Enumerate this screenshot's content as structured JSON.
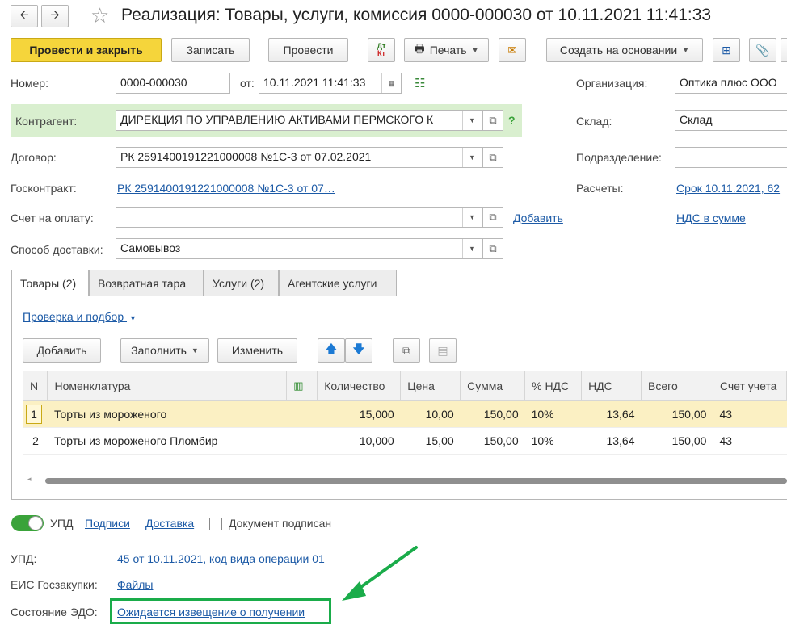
{
  "window": {
    "title": "Реализация: Товары, услуги, комиссия 0000-000030 от 10.11.2021 11:41:33"
  },
  "toolbar": {
    "post_close": "Провести и закрыть",
    "save": "Записать",
    "post": "Провести",
    "dtkt": "Дт Кт",
    "print": "Печать",
    "create_based": "Создать на основании"
  },
  "form": {
    "number_label": "Номер:",
    "number": "0000-000030",
    "from_label": "от:",
    "date": "10.11.2021 11:41:33",
    "org_label": "Организация:",
    "org": "Оптика плюс ООО",
    "contractor_label": "Контрагент:",
    "contractor": "ДИРЕКЦИЯ ПО УПРАВЛЕНИЮ АКТИВАМИ ПЕРМСКОГО К",
    "help": "?",
    "warehouse_label": "Склад:",
    "warehouse": "Склад",
    "contract_label": "Договор:",
    "contract": "РК 2591400191221000008 №1С-3 от 07.02.2021",
    "division_label": "Подразделение:",
    "division": "",
    "gov_contract_label": "Госконтракт:",
    "gov_contract": "РК 2591400191221000008 №1С-3 от 07…",
    "settlements_label": "Расчеты:",
    "settlements": "Срок 10.11.2021, 62",
    "invoice_label": "Счет на оплату:",
    "invoice": "",
    "add_link": "Добавить",
    "vat_link": "НДС в сумме",
    "delivery_label": "Способ доставки:",
    "delivery": "Самовывоз"
  },
  "tabs": [
    {
      "label": "Товары (2)"
    },
    {
      "label": "Возвратная тара"
    },
    {
      "label": "Услуги (2)"
    },
    {
      "label": "Агентские услуги"
    }
  ],
  "goods": {
    "check_link": "Проверка и подбор",
    "add": "Добавить",
    "fill": "Заполнить",
    "edit": "Изменить",
    "columns": [
      "N",
      "Номенклатура",
      "",
      "Количество",
      "Цена",
      "Сумма",
      "% НДС",
      "НДС",
      "Всего",
      "Счет учета"
    ],
    "rows": [
      {
        "n": "1",
        "name": "Торты из мороженого",
        "qty": "15,000",
        "price": "10,00",
        "sum": "150,00",
        "vat_rate": "10%",
        "vat": "13,64",
        "total": "150,00",
        "account": "43"
      },
      {
        "n": "2",
        "name": "Торты из мороженого Пломбир",
        "qty": "10,000",
        "price": "15,00",
        "sum": "150,00",
        "vat_rate": "10%",
        "vat": "13,64",
        "total": "150,00",
        "account": "43"
      }
    ]
  },
  "footer": {
    "upd_toggle": "УПД",
    "signatures": "Подписи",
    "delivery": "Доставка",
    "signed": "Документ подписан",
    "upd_label": "УПД:",
    "upd_value": "45 от 10.11.2021, код вида операции 01",
    "eis_label": "ЕИС Госзакупки:",
    "eis_value": "Файлы",
    "edo_label": "Состояние ЭДО:",
    "edo_value": "Ожидается извещение о получении"
  },
  "colors": {
    "primary_button": "#f5d53b",
    "contractor_highlight": "#d9efcf",
    "selected_row": "#fbf0c3",
    "link": "#1c5aa6",
    "annotation": "#1aac4a"
  }
}
